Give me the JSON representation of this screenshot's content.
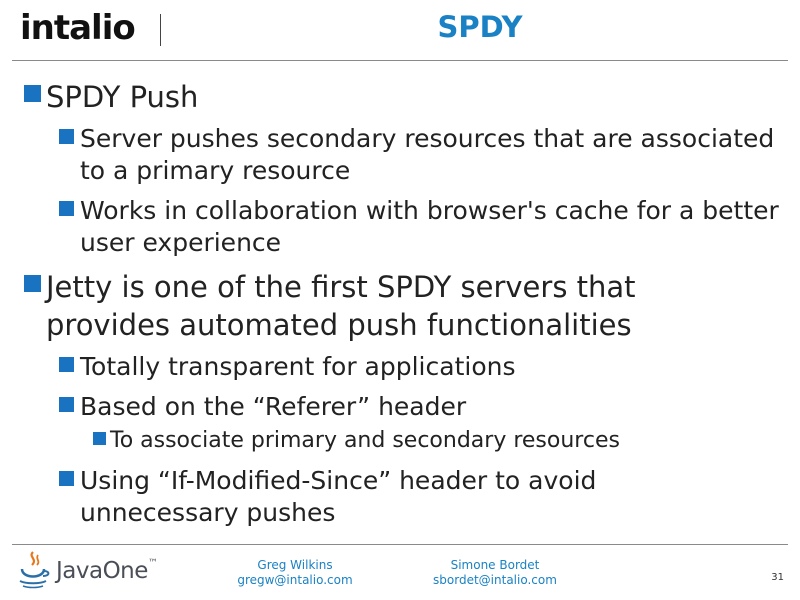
{
  "header": {
    "logo": "intalio",
    "title": "SPDY"
  },
  "bullets": [
    {
      "level": 1,
      "text": "SPDY Push"
    },
    {
      "level": 2,
      "text": "Server pushes secondary resources that are associated to a primary resource"
    },
    {
      "level": 2,
      "text": "Works in collaboration with browser's cache for a better user experience"
    },
    {
      "level": 1,
      "text": "Jetty is one of the first SPDY servers that provides automated push functionalities"
    },
    {
      "level": 2,
      "text": "Totally transparent for applications"
    },
    {
      "level": 2,
      "text": "Based on the “Referer” header"
    },
    {
      "level": 3,
      "text": "To associate primary and secondary resources"
    },
    {
      "level": 2,
      "text": "Using “If-Modified-Since” header to avoid unnecessary pushes"
    }
  ],
  "footer": {
    "brand": "JavaOne",
    "trademark": "™",
    "authors": [
      {
        "name": "Greg Wilkins",
        "email": "gregw@intalio.com"
      },
      {
        "name": "Simone Bordet",
        "email": "sbordet@intalio.com"
      }
    ],
    "page_number": "31"
  },
  "colors": {
    "accent": "#1a82c4",
    "bullet": "#1a73c0"
  }
}
